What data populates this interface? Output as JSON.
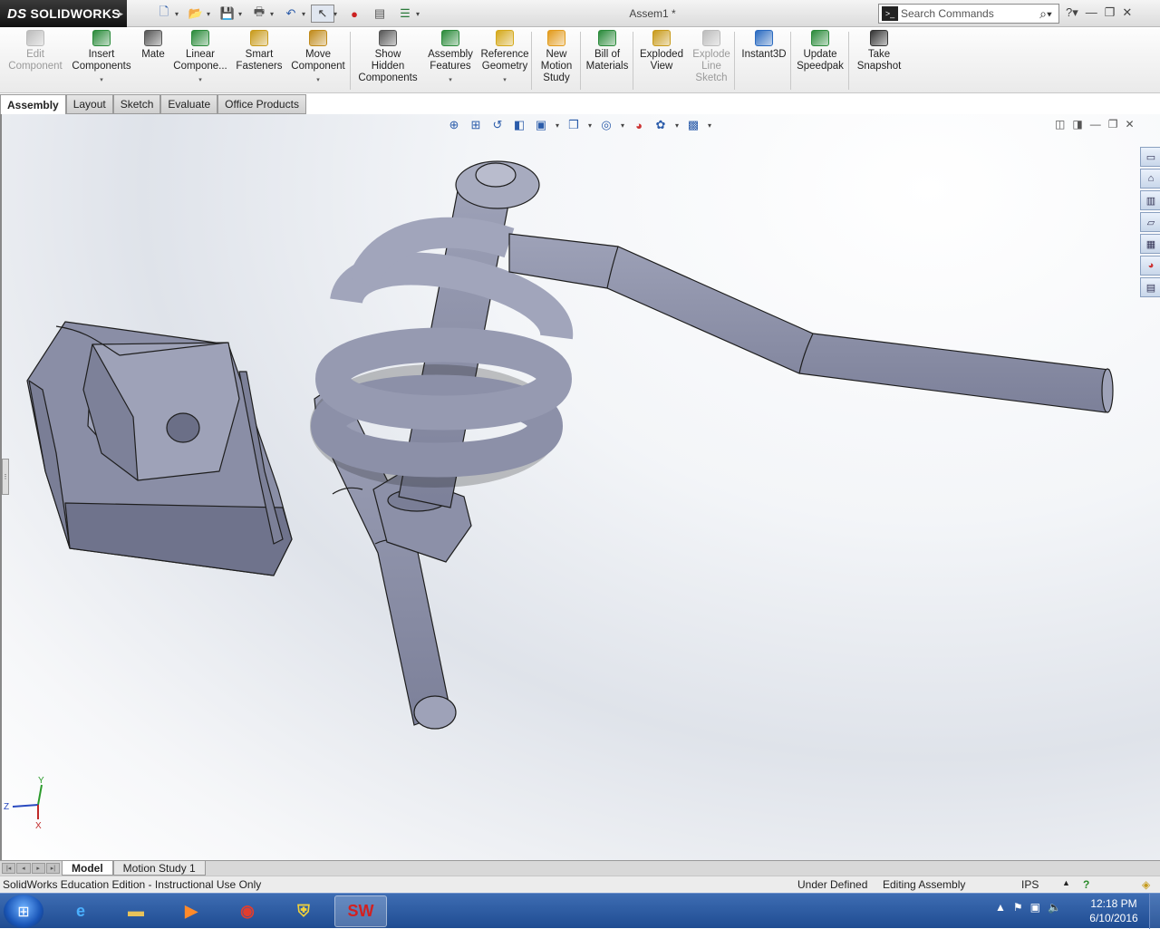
{
  "app": {
    "name": "SOLIDWORKS",
    "logo_prefix": "DS",
    "document_title": "Assem1 *"
  },
  "search": {
    "placeholder": "Search Commands"
  },
  "ribbon": [
    {
      "id": "edit-component",
      "lines": [
        "Edit",
        "Component"
      ],
      "disabled": true,
      "dropdown": false
    },
    {
      "id": "insert-components",
      "lines": [
        "Insert",
        "Components"
      ],
      "disabled": false,
      "dropdown": true
    },
    {
      "id": "mate",
      "lines": [
        "Mate"
      ],
      "disabled": false,
      "dropdown": false
    },
    {
      "id": "linear-component-pattern",
      "lines": [
        "Linear",
        "Compone..."
      ],
      "disabled": false,
      "dropdown": true
    },
    {
      "id": "smart-fasteners",
      "lines": [
        "Smart",
        "Fasteners"
      ],
      "disabled": false,
      "dropdown": false
    },
    {
      "id": "move-component",
      "lines": [
        "Move",
        "Component"
      ],
      "disabled": false,
      "dropdown": true
    },
    {
      "id": "show-hidden-components",
      "lines": [
        "Show",
        "Hidden",
        "Components"
      ],
      "disabled": false,
      "dropdown": false
    },
    {
      "id": "assembly-features",
      "lines": [
        "Assembly",
        "Features"
      ],
      "disabled": false,
      "dropdown": true
    },
    {
      "id": "reference-geometry",
      "lines": [
        "Reference",
        "Geometry"
      ],
      "disabled": false,
      "dropdown": true
    },
    {
      "id": "new-motion-study",
      "lines": [
        "New",
        "Motion",
        "Study"
      ],
      "disabled": false,
      "dropdown": false
    },
    {
      "id": "bill-of-materials",
      "lines": [
        "Bill of",
        "Materials"
      ],
      "disabled": false,
      "dropdown": false
    },
    {
      "id": "exploded-view",
      "lines": [
        "Exploded",
        "View"
      ],
      "disabled": false,
      "dropdown": false
    },
    {
      "id": "explode-line-sketch",
      "lines": [
        "Explode",
        "Line",
        "Sketch"
      ],
      "disabled": true,
      "dropdown": false
    },
    {
      "id": "instant3d",
      "lines": [
        "Instant3D"
      ],
      "disabled": false,
      "dropdown": false
    },
    {
      "id": "update-speedpak",
      "lines": [
        "Update",
        "Speedpak"
      ],
      "disabled": false,
      "dropdown": false
    },
    {
      "id": "take-snapshot",
      "lines": [
        "Take",
        "Snapshot"
      ],
      "disabled": false,
      "dropdown": false
    }
  ],
  "tabs": [
    "Assembly",
    "Layout",
    "Sketch",
    "Evaluate",
    "Office Products"
  ],
  "active_tab": "Assembly",
  "bottom_tabs": [
    "Model",
    "Motion Study 1"
  ],
  "active_bottom_tab": "Model",
  "status": {
    "edition": "SolidWorks Education Edition - Instructional Use Only",
    "definition": "Under Defined",
    "mode": "Editing Assembly",
    "units": "IPS"
  },
  "taskbar": {
    "time": "12:18 PM",
    "date": "6/10/2016"
  },
  "colors": {
    "part_fill": "#8f93ab",
    "part_edge": "#222222",
    "taskbar": "#2a5aa0",
    "accent": "#2b5caa"
  },
  "triad": {
    "x": "X",
    "y": "Y",
    "z": "Z"
  }
}
